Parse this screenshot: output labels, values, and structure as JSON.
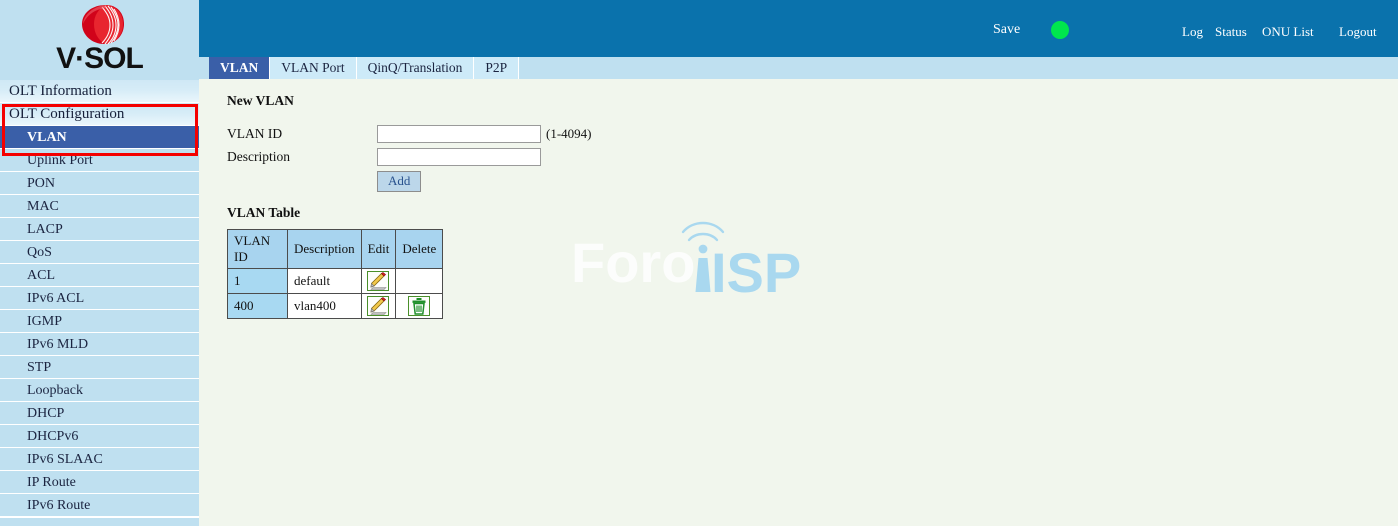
{
  "brand": {
    "logo_icon": "vsol-sphere-logo-icon",
    "wordmark": "V·SOL"
  },
  "sidebar": {
    "groups": [
      {
        "type": "group",
        "label": "OLT Information",
        "selected": false
      },
      {
        "type": "group",
        "label": "OLT Configuration",
        "selected": false
      },
      {
        "type": "item",
        "label": "VLAN",
        "selected": true
      },
      {
        "type": "item",
        "label": "Uplink Port",
        "selected": false
      },
      {
        "type": "item",
        "label": "PON",
        "selected": false
      },
      {
        "type": "item",
        "label": "MAC",
        "selected": false
      },
      {
        "type": "item",
        "label": "LACP",
        "selected": false
      },
      {
        "type": "item",
        "label": "QoS",
        "selected": false
      },
      {
        "type": "item",
        "label": "ACL",
        "selected": false
      },
      {
        "type": "item",
        "label": "IPv6 ACL",
        "selected": false
      },
      {
        "type": "item",
        "label": "IGMP",
        "selected": false
      },
      {
        "type": "item",
        "label": "IPv6 MLD",
        "selected": false
      },
      {
        "type": "item",
        "label": "STP",
        "selected": false
      },
      {
        "type": "item",
        "label": "Loopback",
        "selected": false
      },
      {
        "type": "item",
        "label": "DHCP",
        "selected": false
      },
      {
        "type": "item",
        "label": "DHCPv6",
        "selected": false
      },
      {
        "type": "item",
        "label": "IPv6 SLAAC",
        "selected": false
      },
      {
        "type": "item",
        "label": "IP Route",
        "selected": false
      },
      {
        "type": "item",
        "label": "IPv6 Route",
        "selected": false
      }
    ]
  },
  "header": {
    "save_label": "Save",
    "status_indicator_icon": "green-status-dot-icon",
    "status_indicator_color": "#00e64d",
    "links": [
      {
        "label": "Log"
      },
      {
        "label": "Status"
      },
      {
        "label": "ONU List"
      }
    ],
    "logout_label": "Logout",
    "background_color": "#0a72ac"
  },
  "tabs": [
    {
      "label": "VLAN",
      "active": true
    },
    {
      "label": "VLAN Port",
      "active": false
    },
    {
      "label": "QinQ/Translation",
      "active": false
    },
    {
      "label": "P2P",
      "active": false
    }
  ],
  "new_vlan": {
    "title": "New VLAN",
    "vlan_id_label": "VLAN ID",
    "vlan_id_value": "",
    "vlan_id_placeholder": "",
    "vlan_id_hint": "(1-4094)",
    "description_label": "Description",
    "description_value": "",
    "description_placeholder": "",
    "add_label": "Add"
  },
  "vlan_table": {
    "title": "VLAN Table",
    "columns": [
      "VLAN ID",
      "Description",
      "Edit",
      "Delete"
    ],
    "rows": [
      {
        "vlan_id": "1",
        "description": "default",
        "edit_icon": "pencil-edit-icon",
        "delete_icon": ""
      },
      {
        "vlan_id": "400",
        "description": "vlan400",
        "edit_icon": "pencil-edit-icon",
        "delete_icon": "trash-delete-icon"
      }
    ]
  },
  "watermark": {
    "text_primary": "Foro",
    "text_accent": "ISP",
    "accent_color": "#a9d8ef"
  },
  "annotation": {
    "type": "red-highlight-rectangle",
    "color": "#f40000"
  }
}
